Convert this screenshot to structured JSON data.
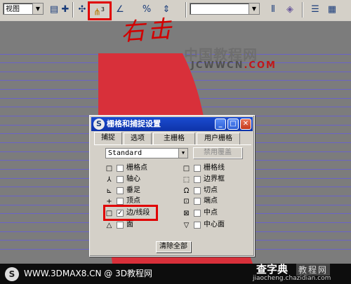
{
  "toolbar": {
    "view_select": "视图",
    "snap_value": "3",
    "handwriting": "右击",
    "selection_set_value": ""
  },
  "watermark": {
    "brand_cn": "中国教程网",
    "brand_url_blue": "JCWWCN",
    "brand_url_red": ".COM"
  },
  "dialog": {
    "title": "栅格和捕捉设置",
    "tabs": [
      "捕捉",
      "选项",
      "主栅格",
      "用户栅格"
    ],
    "preset": "Standard",
    "override_label": "禁用覆盖",
    "left_items": [
      {
        "label": "栅格点",
        "checked": false
      },
      {
        "label": "轴心",
        "checked": false
      },
      {
        "label": "垂足",
        "checked": false
      },
      {
        "label": "顶点",
        "checked": false
      },
      {
        "label": "边/线段",
        "checked": true
      },
      {
        "label": "面",
        "checked": false
      }
    ],
    "right_items": [
      {
        "label": "栅格线",
        "checked": false
      },
      {
        "label": "边界框",
        "checked": false
      },
      {
        "label": "切点",
        "checked": false
      },
      {
        "label": "端点",
        "checked": false
      },
      {
        "label": "中点",
        "checked": false
      },
      {
        "label": "中心面",
        "checked": false
      }
    ],
    "clear_all": "清除全部"
  },
  "footer": {
    "text": "WWW.3DMAX8.CN @ 3D教程网",
    "site_name": "查字典",
    "site_tag": "教程网",
    "site_url": "jiaocheng.chazidian.com"
  },
  "colors": {
    "titlebar": "#1a4bd0",
    "highlight": "#e00000",
    "red_shape": "#d8303a",
    "grid_lines": "#6a63c8"
  }
}
